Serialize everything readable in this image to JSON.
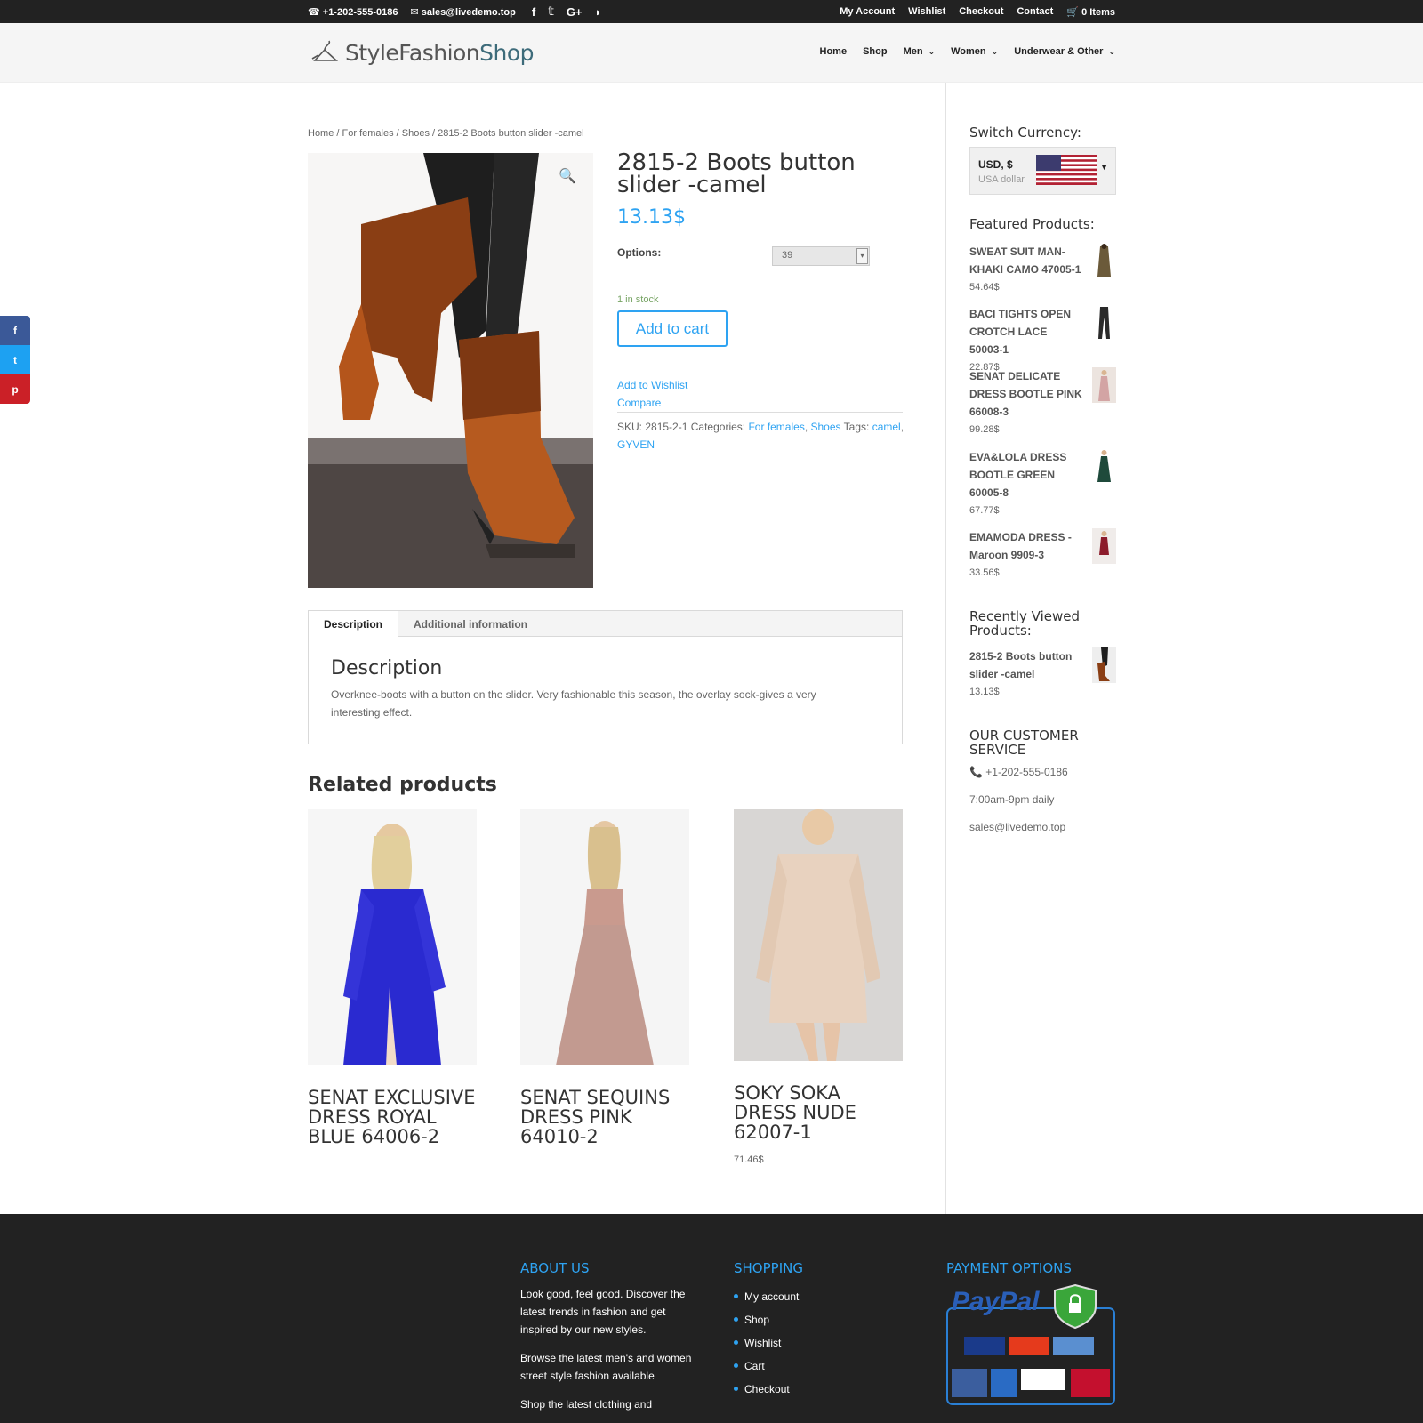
{
  "topbar": {
    "phone": "+1-202-555-0186",
    "email": "sales@livedemo.top",
    "links": [
      "My Account",
      "Wishlist",
      "Checkout",
      "Contact"
    ],
    "cart": "0 Items"
  },
  "header": {
    "logo_main": "StyleFashion",
    "logo_accent": "Shop",
    "nav": [
      {
        "label": "Home",
        "has_dropdown": false
      },
      {
        "label": "Shop",
        "has_dropdown": false
      },
      {
        "label": "Men",
        "has_dropdown": true
      },
      {
        "label": "Women",
        "has_dropdown": true
      },
      {
        "label": "Underwear & Other",
        "has_dropdown": true
      }
    ]
  },
  "breadcrumb": "Home / For females / Shoes / 2815-2 Boots button slider -camel",
  "product": {
    "title": "2815-2 Boots button slider -camel",
    "price": "13.13$",
    "options_label": "Options:",
    "options_value": "39",
    "stock": "1 in stock",
    "add_to_cart": "Add to cart",
    "wishlist": "Add to Wishlist",
    "compare": "Compare",
    "sku_label": "SKU:",
    "sku": "2815-2-1",
    "categories_label": "Categories:",
    "categories": [
      "For females",
      "Shoes"
    ],
    "tags_label": "Tags:",
    "tags": [
      "camel",
      "GYVEN"
    ]
  },
  "tabs": {
    "items": [
      "Description",
      "Additional information"
    ],
    "active": "Description",
    "heading": "Description",
    "body": "Overknee-boots with a button on the slider. Very fashionable this season, the overlay sock-gives a very interesting effect."
  },
  "related": {
    "title": "Related products",
    "items": [
      {
        "name": "SENAT EXCLUSIVE DRESS ROYAL BLUE 64006-2",
        "price": ""
      },
      {
        "name": "SENAT SEQUINS DRESS PINK 64010-2",
        "price": ""
      },
      {
        "name": "SOKY SOKA DRESS NUDE 62007-1",
        "price": "71.46$"
      }
    ]
  },
  "sidebar": {
    "currency_title": "Switch Currency:",
    "currency_code": "USD, $",
    "currency_name": "USA dollar",
    "featured_title": "Featured Products:",
    "featured": [
      {
        "name": "SWEAT SUIT MAN-KHAKI CAMO 47005-1",
        "price": "54.64$"
      },
      {
        "name": "BACI TIGHTS OPEN CROTCH LACE 50003-1",
        "price": "22.87$"
      },
      {
        "name": "SENAT DELICATE DRESS BOOTLE PINK 66008-3",
        "price": "99.28$"
      },
      {
        "name": "EVA&LOLA DRESS BOOTLE GREEN 60005-8",
        "price": "67.77$"
      },
      {
        "name": "EMAMODA DRESS - Maroon 9909-3",
        "price": "33.56$"
      }
    ],
    "recent_title": "Recently Viewed Products:",
    "recent": [
      {
        "name": "2815-2 Boots button slider -camel",
        "price": "13.13$"
      }
    ],
    "service_title": "OUR CUSTOMER SERVICE",
    "service_phone": "+1-202-555-0186",
    "service_hours": "7:00am-9pm daily",
    "service_email": "sales@livedemo.top"
  },
  "footer": {
    "about_title": "ABOUT US",
    "about_p1": "Look good, feel good. Discover the latest trends in fashion and get inspired by our new styles.",
    "about_p2": "Browse the latest men's and women street style fashion available",
    "about_p3": "Shop the latest clothing and",
    "shopping_title": "SHOPPING",
    "shopping_links": [
      "My account",
      "Shop",
      "Wishlist",
      "Cart",
      "Checkout"
    ],
    "payment_title": "PAYMENT OPTIONS"
  },
  "colors": {
    "accent": "#2ea3f2",
    "topbar": "#222222",
    "footer": "#222222"
  }
}
